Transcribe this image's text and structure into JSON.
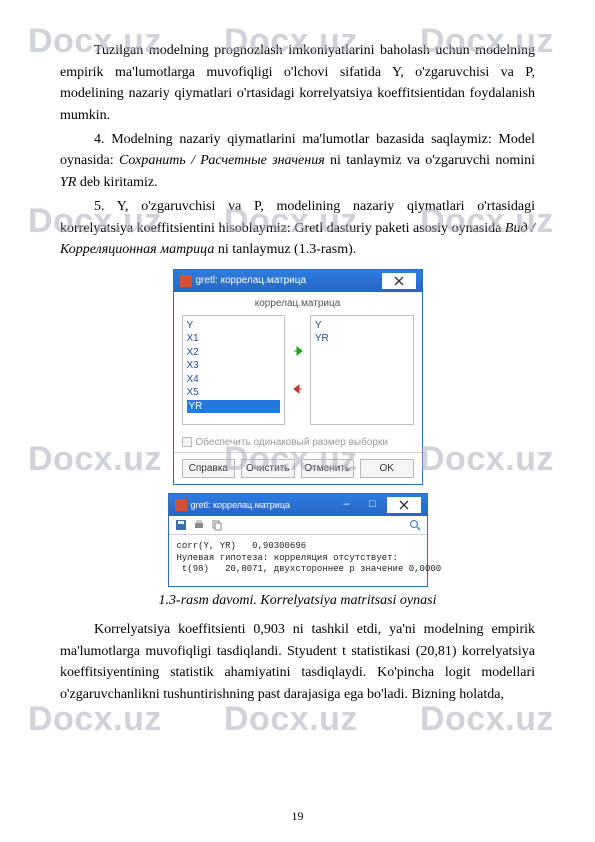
{
  "watermark": "Docx.uz",
  "paragraphs": {
    "p1": "Tuzilgan modelning prognozlash imkoniyatlarini baholash uchun modelning empirik ma'lumotlarga muvofiqligi o'lchovi sifatida Y, o'zgaruvchisi va P, modelining nazariy qiymatlari o'rtasidagi korrelyatsiya koeffitsientidan foydalanish mumkin.",
    "p2_a": "4. Modelning nazariy qiymatlarini ma'lumotlar bazasida saqlaymiz: Model oynasida: ",
    "p2_b": "Сохранить / Расчетные значения",
    "p2_c": " ni tanlaymiz va o'zgaruvchi nomini ",
    "p2_d": "YR",
    "p2_e": " deb kiritamiz.",
    "p3_a": "5. Y, o'zgaruvchisi va P, modelining nazariy qiymatlari o'rtasidagi korrelyatsiya koeffitsientini hisoblaymiz: Gretl dasturiy paketi asosiy oynasida ",
    "p3_b": "Вид / Корреляционная матрица",
    "p3_c": " ni tanlaymuz (1.3-rasm).",
    "p4": "Korrelyatsiya koeffitsienti 0,903 ni tashkil etdi, ya'ni modelning empirik ma'lumotlarga muvofiqligi tasdiqlandi. Styudent t statistikasi (20,81) korrelyatsiya koeffitsiyentining statistik ahamiyatini tasdiqlaydi. Ko'pincha logit modellari o'zgaruvchanlikni tushuntirishning past darajasiga ega bo'ladi. Bizning holatda,"
  },
  "caption": "1.3-rasm davomi. Korrelyatsiya matritsasi oynasi",
  "page_number": "19",
  "dlg1": {
    "title": "gretl: коррелац.матрица",
    "subtitle": "коррелац.матрица",
    "left_list": [
      "Y",
      "X1",
      "X2",
      "X3",
      "X4",
      "X5",
      "YR"
    ],
    "right_list": [
      "Y",
      "YR"
    ],
    "checkbox": "Обеспечить одинаковый размер выборки",
    "buttons": {
      "help": "Справка",
      "clear": "Очистить",
      "cancel": "Отменить",
      "ok": "OK"
    }
  },
  "dlg2": {
    "title": "gretl: коррелац.матрица",
    "line1": "corr(Y, YR)   0,90300696",
    "line2": "Нулевая гипотеза: корреляция отсутствует:",
    "line3": "t(98)   20,8071, двухстороннее р значение 0,0000"
  }
}
